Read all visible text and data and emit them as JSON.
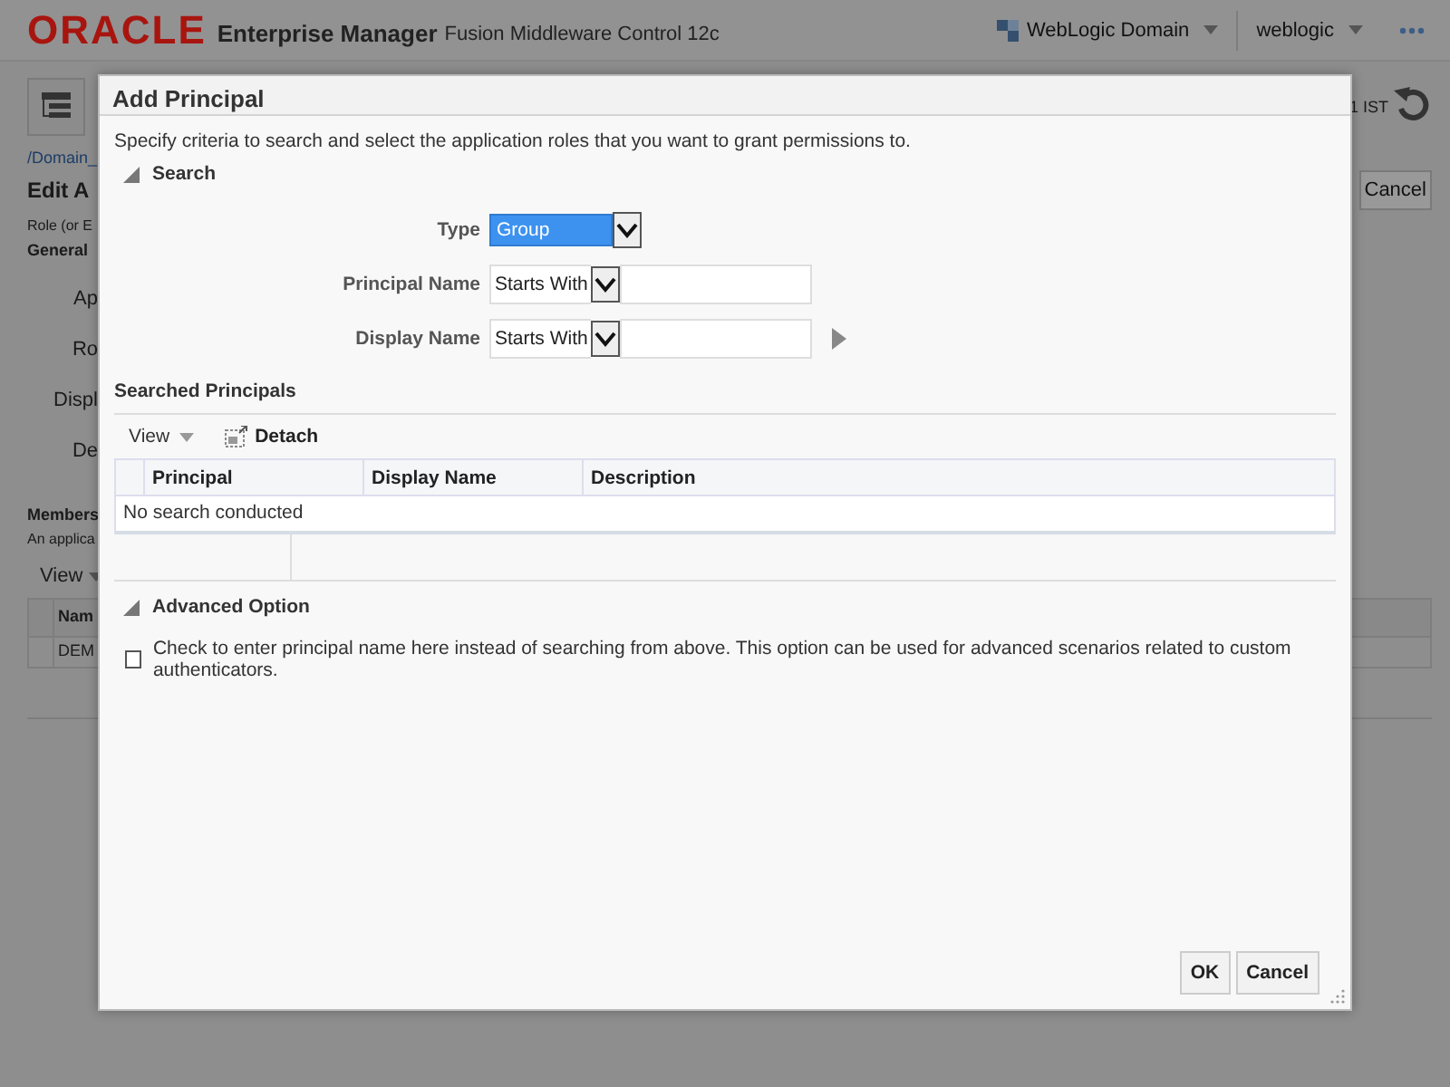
{
  "header": {
    "logo": "ORACLE",
    "product": "Enterprise Manager",
    "subtitle": "Fusion Middleware Control 12c",
    "domain_menu": "WebLogic Domain",
    "user_menu": "weblogic"
  },
  "background": {
    "time": "1 IST",
    "breadcrumb": "/Domain_",
    "title": "Edit A",
    "cancel": "Cancel",
    "role_text": "Role (or E",
    "general": "General",
    "labels": [
      "Ap",
      "Ro",
      "Displ",
      "De"
    ],
    "members": "Members",
    "members_text": "An applica",
    "view": "View",
    "table_header": "Nam",
    "table_cell": "DEM"
  },
  "dialog": {
    "title": "Add Principal",
    "instruction": "Specify criteria to search and select the application roles that you want to grant permissions to.",
    "search_section": {
      "label": "Search",
      "expanded": true
    },
    "fields": [
      {
        "label": "Type",
        "kind": "select",
        "value": "Group"
      },
      {
        "label": "Principal Name",
        "kind": "operator",
        "operator": "Starts With"
      },
      {
        "label": "Display Name",
        "kind": "operator",
        "operator": "Starts With"
      }
    ],
    "results": {
      "title": "Searched Principals",
      "view": "View",
      "detach": "Detach",
      "columns": [
        "Principal",
        "Display Name",
        "Description"
      ],
      "empty": "No search conducted"
    },
    "advanced": {
      "label": "Advanced Option",
      "expanded": true,
      "option": {
        "label": "Check to enter principal name here instead of searching from above. This option can be used for advanced scenarios related to custom authenticators.",
        "checked": false
      }
    },
    "buttons": [
      "OK",
      "Cancel"
    ]
  }
}
